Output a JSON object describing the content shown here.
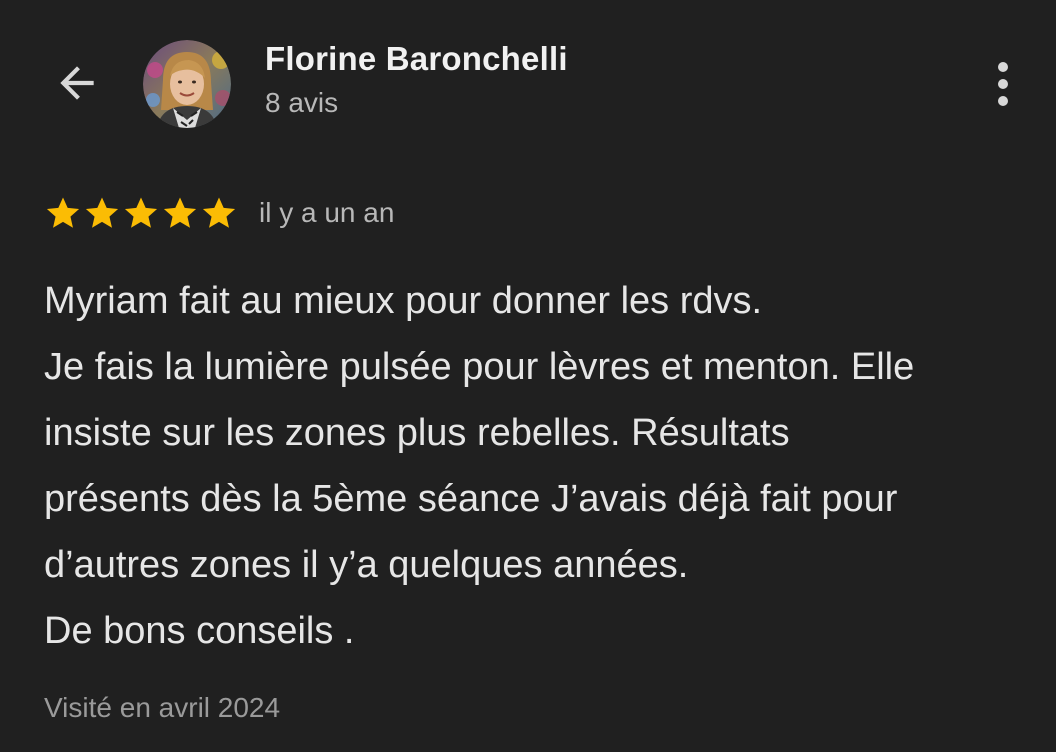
{
  "header": {
    "back_icon": "arrow-back-icon",
    "avatar_icon": "user-avatar",
    "author_name": "Florine Baronchelli",
    "review_count": "8 avis",
    "more_icon": "more-vert-icon"
  },
  "review": {
    "rating": 5,
    "rating_max": 5,
    "star_color": "#fbbc04",
    "date": "il y a un an",
    "lines": [
      "Myriam fait au mieux pour donner les rdvs.",
      "Je fais la lumière pulsée pour lèvres et menton. Elle",
      "insiste sur les zones plus rebelles. Résultats",
      "présents dès la 5ème séance J’avais déjà fait pour",
      "d’autres zones il y’a quelques années.",
      "De bons conseils ."
    ],
    "visit": "Visité en avril 2024"
  }
}
